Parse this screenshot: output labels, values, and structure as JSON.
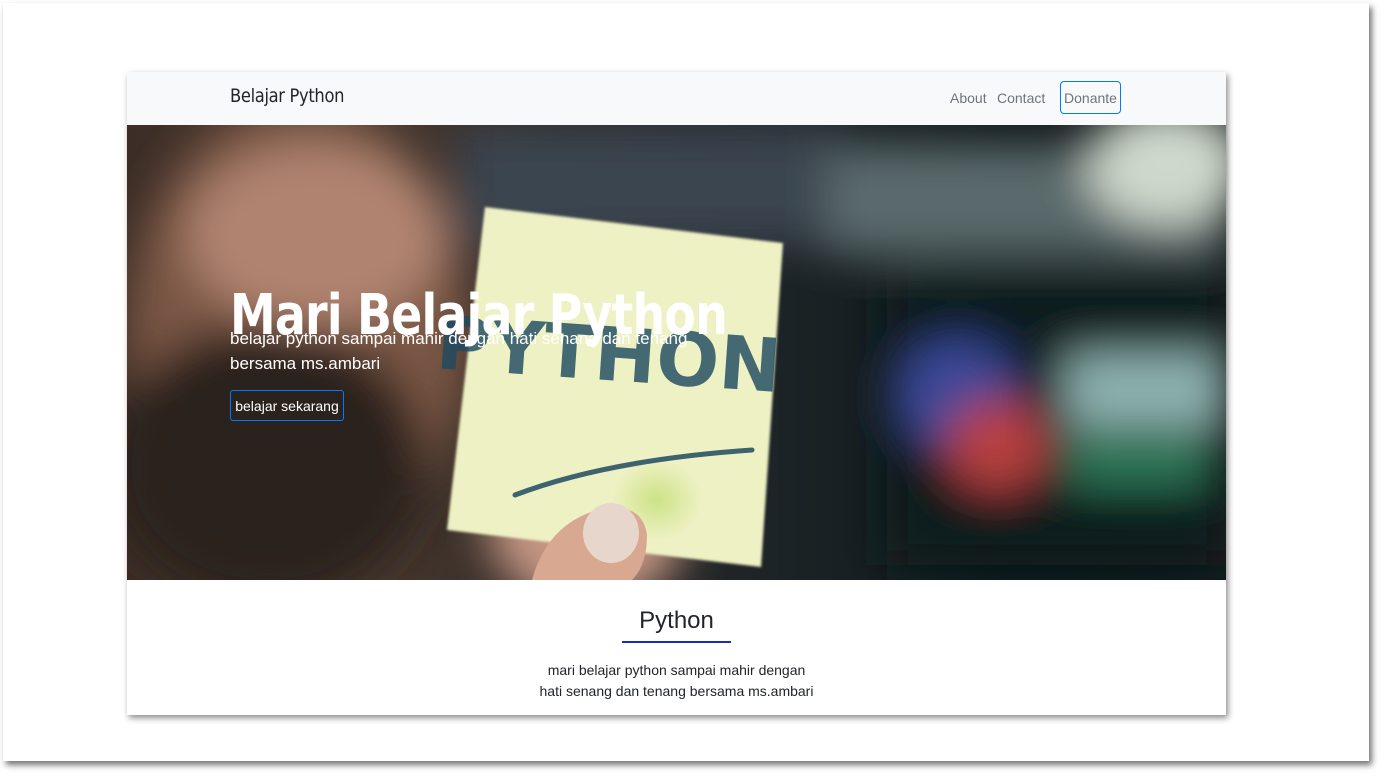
{
  "navbar": {
    "brand": "Belajar Python",
    "links": [
      "About",
      "Contact"
    ],
    "donate_label": "Donante"
  },
  "hero": {
    "title": "Mari Belajar Python",
    "lead_line1": "belajar python sampai mahir dengan hati senang dan tenang",
    "lead_line2": "bersama ms.ambari",
    "button_label": "belajar sekarang",
    "note_text": "PYTHON"
  },
  "section": {
    "title": "Python",
    "text_line1": "mari belajar python sampai mahir dengan",
    "text_line2": "hati senang dan tenang bersama ms.ambari"
  },
  "colors": {
    "primary": "#007bff",
    "navbar_bg": "#f8f9fa",
    "underline": "#1a2fb0",
    "sticky_note": "#eef1c4"
  }
}
